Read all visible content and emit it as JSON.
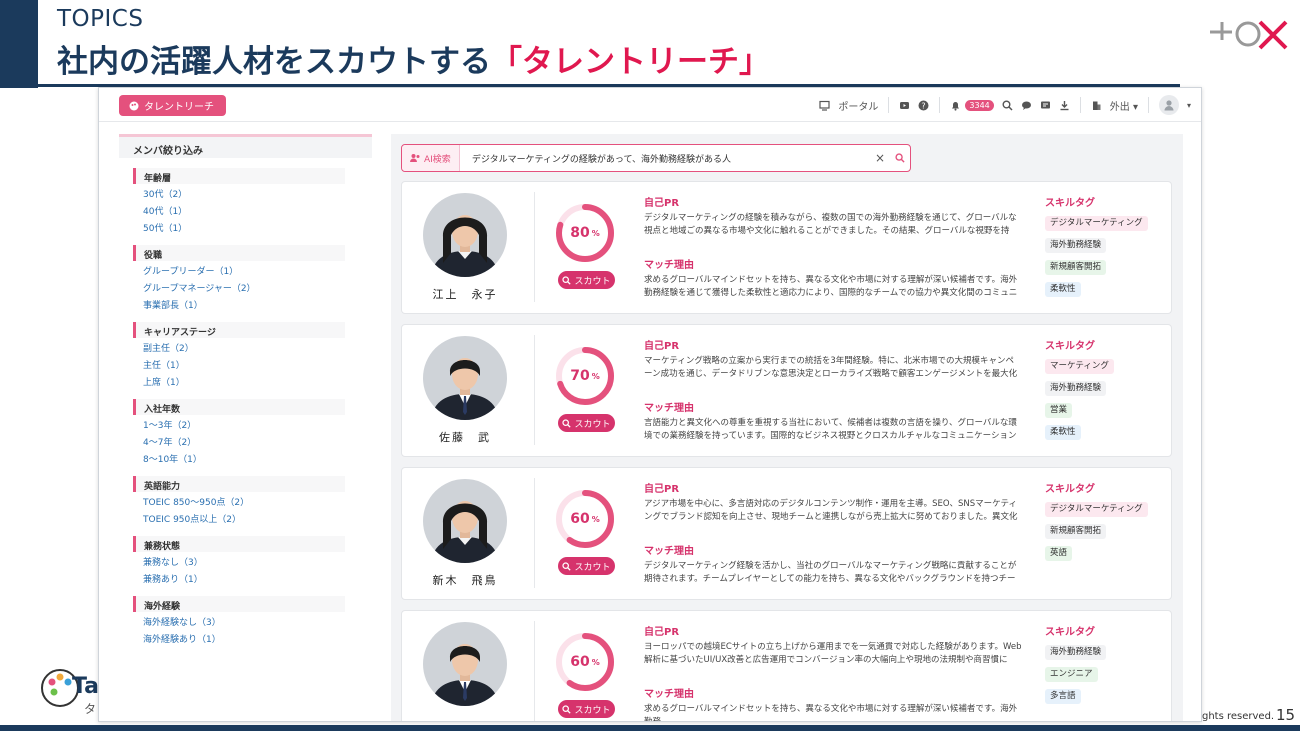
{
  "slide": {
    "topics": "TOPICS",
    "title_main": "社内の活躍人材をスカウトする",
    "title_accent": "「タレントリーチ」",
    "copyright": "ghts reserved.",
    "page_number": "15",
    "bottom_logo_text": "Tal",
    "bottom_logo_sub": "タ"
  },
  "app": {
    "brand": "タレントリーチ",
    "nav": {
      "portal": "ポータル",
      "notification_count": "3344",
      "status": "外出"
    }
  },
  "sidebar": {
    "title": "メンバ絞り込み",
    "groups": [
      {
        "title": "年齢層",
        "items": [
          "30代（2）",
          "40代（1）",
          "50代（1）"
        ]
      },
      {
        "title": "役職",
        "items": [
          "グループリーダー（1）",
          "グループマネージャー（2）",
          "事業部長（1）"
        ]
      },
      {
        "title": "キャリアステージ",
        "items": [
          "副主任（2）",
          "主任（1）",
          "上席（1）"
        ]
      },
      {
        "title": "入社年数",
        "items": [
          "1〜3年（2）",
          "4〜7年（2）",
          "8〜10年（1）"
        ]
      },
      {
        "title": "英語能力",
        "items": [
          "TOEIC 850〜950点（2）",
          "TOEIC 950点以上（2）"
        ]
      },
      {
        "title": "兼務状態",
        "items": [
          "兼務なし（3）",
          "兼務あり（1）"
        ]
      },
      {
        "title": "海外経験",
        "items": [
          "海外経験なし（3）",
          "海外経験あり（1）"
        ]
      }
    ]
  },
  "search": {
    "tag": "AI検索",
    "query": "デジタルマーケティングの経験があって、海外勤務経験がある人"
  },
  "labels": {
    "pr": "自己PR",
    "match": "マッチ理由",
    "skills": "スキルタグ",
    "scout": "スカウト",
    "percent": "%"
  },
  "colors": {
    "accent": "#d6336c",
    "navy": "#1b3a5c"
  },
  "candidates": [
    {
      "name": "江上　永子",
      "score": 80,
      "pr": "デジタルマーケティングの経験を積みながら、複数の国での海外勤務経験を通じて、グローバルな視点と地域ごの異なる市場や文化に触れることができました。その結果、グローバルな視野を持ち、…",
      "match": "求めるグローバルマインドセットを持ち、異なる文化や市場に対する理解が深い候補者です。海外勤務経験を通じて獲得した柔軟性と適応力により、国際的なチームでの協力や異文化間のコミュニケ…",
      "tags": [
        {
          "t": "デジタルマーケティング",
          "c": "pink"
        },
        {
          "t": "海外勤務経験",
          "c": "gray"
        },
        {
          "t": "新規顧客開拓",
          "c": "green"
        },
        {
          "t": "柔軟性",
          "c": "blue"
        }
      ]
    },
    {
      "name": "佐藤　武",
      "score": 70,
      "pr": "マーケティング戦略の立案から実行までの統括を3年間経験。特に、北米市場での大規模キャンペーン成功を通じ、データドリブンな意思決定とローカライズ戦略で顧客エンゲージメントを最大化を…",
      "match": "言語能力と異文化への尊重を重視する当社において、候補者は複数の言語を操り、グローバルな環境での業務経験を持っています。国際的なビジネス視野とクロスカルチャルなコミュニケーションス…",
      "tags": [
        {
          "t": "マーケティング",
          "c": "pink"
        },
        {
          "t": "海外勤務経験",
          "c": "gray"
        },
        {
          "t": "営業",
          "c": "green"
        },
        {
          "t": "柔軟性",
          "c": "blue"
        }
      ]
    },
    {
      "name": "新木　飛鳥",
      "score": 60,
      "pr": "アジア市場を中心に、多言語対応のデジタルコンテンツ制作・運用を主導。SEO、SNSマーケティングでブランド認知を向上させ、現地チームと連携しながら売上拡大に努めておりました。異文化理…",
      "match": "デジタルマーケティング経験を活かし、当社のグローバルなマーケティング戦略に貢献することが期待されます。チームプレイヤーとしての能力を持ち、異なる文化やバックグラウンドを持つチーム…",
      "tags": [
        {
          "t": "デジタルマーケティング",
          "c": "pink"
        },
        {
          "t": "新規顧客開拓",
          "c": "gray"
        },
        {
          "t": "英語",
          "c": "green"
        }
      ]
    },
    {
      "name": "",
      "score": 60,
      "pr": "ヨーロッパでの越境ECサイトの立ち上げから運用までを一気通貫で対応した経験があります。Web解析に基づいたUI/UX改善と広告運用でコンバージョン率の大幅向上や現地の法規制や商習慣に対…",
      "match": "求めるグローバルマインドセットを持ち、異なる文化や市場に対する理解が深い候補者です。海外勤務",
      "tags": [
        {
          "t": "海外勤務経験",
          "c": "gray"
        },
        {
          "t": "エンジニア",
          "c": "green"
        },
        {
          "t": "多言語",
          "c": "blue"
        }
      ]
    }
  ]
}
